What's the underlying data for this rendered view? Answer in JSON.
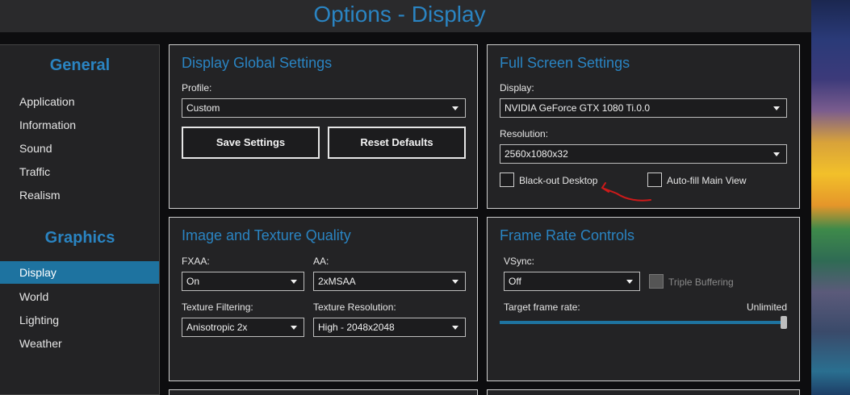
{
  "window": {
    "title": "Options - Display"
  },
  "sidebar": {
    "general_heading": "General",
    "general_items": [
      {
        "label": "Application"
      },
      {
        "label": "Information"
      },
      {
        "label": "Sound"
      },
      {
        "label": "Traffic"
      },
      {
        "label": "Realism"
      }
    ],
    "graphics_heading": "Graphics",
    "graphics_items": [
      {
        "label": "Display",
        "active": true
      },
      {
        "label": "World"
      },
      {
        "label": "Lighting"
      },
      {
        "label": "Weather"
      }
    ]
  },
  "display_global": {
    "title": "Display Global Settings",
    "profile_label": "Profile:",
    "profile_value": "Custom",
    "save_label": "Save Settings",
    "reset_label": "Reset Defaults"
  },
  "full_screen": {
    "title": "Full Screen Settings",
    "display_label": "Display:",
    "display_value": "NVIDIA GeForce GTX 1080 Ti.0.0",
    "resolution_label": "Resolution:",
    "resolution_value": "2560x1080x32",
    "blackout_label": "Black-out Desktop",
    "blackout_checked": false,
    "autofill_label": "Auto-fill Main View",
    "autofill_checked": false
  },
  "image_texture": {
    "title": "Image and Texture Quality",
    "fxaa_label": "FXAA:",
    "fxaa_value": "On",
    "aa_label": "AA:",
    "aa_value": "2xMSAA",
    "filtering_label": "Texture Filtering:",
    "filtering_value": "Anisotropic 2x",
    "resolution_label": "Texture Resolution:",
    "resolution_value": "High - 2048x2048"
  },
  "frame_rate": {
    "title": "Frame Rate Controls",
    "vsync_label": "VSync:",
    "vsync_value": "Off",
    "triple_label": "Triple Buffering",
    "triple_checked": false,
    "triple_enabled": false,
    "target_label": "Target frame rate:",
    "target_value": "Unlimited",
    "target_fraction": 1.0
  },
  "colors": {
    "accent": "#2a84c2",
    "active_item": "#1e73a0",
    "annotation": "#cc1a1a"
  }
}
